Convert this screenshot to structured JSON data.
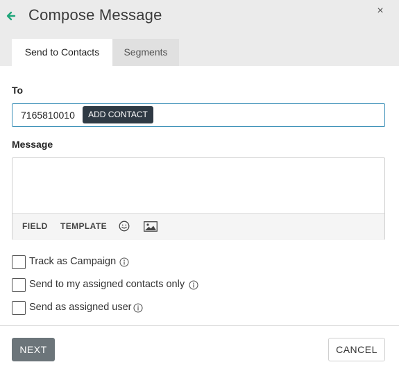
{
  "header": {
    "title": "Compose Message",
    "back_icon": "arrow-left-icon",
    "close_icon": "close-icon",
    "close_glyph": "×"
  },
  "tabs": [
    {
      "label": "Send to Contacts",
      "active": true
    },
    {
      "label": "Segments",
      "active": false
    }
  ],
  "to": {
    "label": "To",
    "value": "7165810010",
    "add_contact_label": "ADD CONTACT"
  },
  "message": {
    "label": "Message",
    "value": "",
    "toolbar": {
      "field_label": "FIELD",
      "template_label": "TEMPLATE",
      "emoji_icon": "smiley-icon",
      "image_icon": "image-icon"
    }
  },
  "options": [
    {
      "label": "Track as Campaign",
      "checked": false
    },
    {
      "label": "Send to my assigned contacts only",
      "checked": false
    },
    {
      "label": "Send as assigned user",
      "checked": false
    }
  ],
  "footer": {
    "next_label": "NEXT",
    "cancel_label": "CANCEL"
  },
  "colors": {
    "accent_green": "#1fa67a",
    "focus_border": "#3a8fb7",
    "dark_button": "#2f3a44",
    "next_button": "#6c757a"
  }
}
